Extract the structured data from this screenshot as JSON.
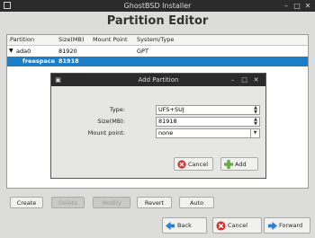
{
  "window": {
    "title": "GhostBSD Installer"
  },
  "page": {
    "heading": "Partition Editor"
  },
  "table": {
    "columns": [
      "Partition",
      "Size(MB)",
      "Mount Point",
      "System/Type"
    ],
    "rows": [
      {
        "partition": "ada0",
        "size": "81920",
        "mount": "",
        "type": "GPT",
        "expanded": true
      },
      {
        "partition": "freespace",
        "size": "81918",
        "mount": "",
        "type": "",
        "selected": true
      }
    ]
  },
  "actions": {
    "create": "Create",
    "delete": "Delete",
    "modify": "Modify",
    "revert": "Revert",
    "auto": "Auto"
  },
  "nav": {
    "back": "Back",
    "cancel": "Cancel",
    "forward": "Forward"
  },
  "dialog": {
    "title": "Add Partition",
    "type_label": "Type:",
    "type_value": "UFS+SUJ",
    "size_label": "Size(MB):",
    "size_value": "81918",
    "mount_label": "Mount point:",
    "mount_value": "none",
    "cancel": "Cancel",
    "add": "Add"
  },
  "colors": {
    "selection": "#1c7ec8",
    "titlebar": "#2b2b2b",
    "cancel_icon": "#d9302c",
    "arrow_icon": "#2f7fd0",
    "add_icon": "#5fb33a"
  }
}
